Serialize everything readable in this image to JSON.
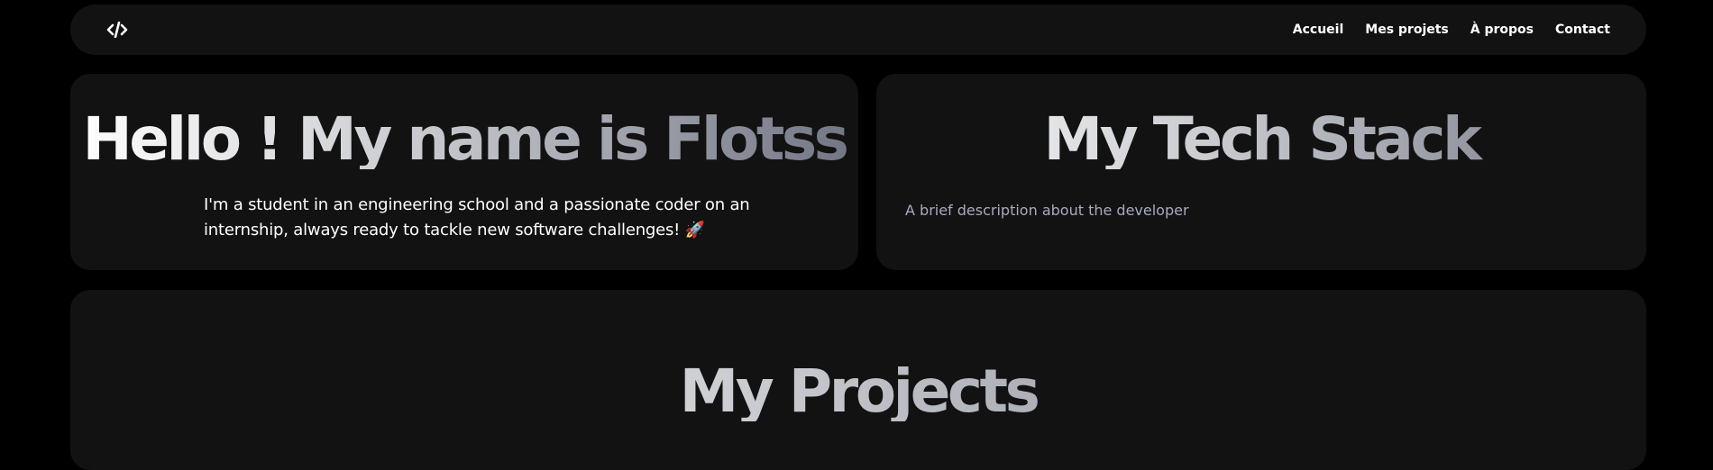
{
  "nav": {
    "logo": {
      "icon": "code-icon"
    },
    "links": [
      {
        "label": "Accueil"
      },
      {
        "label": "Mes projets"
      },
      {
        "label": "À propos"
      },
      {
        "label": "Contact"
      }
    ]
  },
  "hero": {
    "title": "Hello ! My name is Flotss",
    "description": "I'm a student in an engineering school and a passionate coder on an internship, always ready to tackle new software challenges! 🚀",
    "emoji_icon": "rocket-icon"
  },
  "tech_stack": {
    "title": "My Tech Stack",
    "description": "A brief description about the developer"
  },
  "projects": {
    "title": "My Projects"
  },
  "colors": {
    "page_background": "#000000",
    "card_background": "#121212",
    "text_primary": "#ffffff",
    "text_muted": "#a6abc1",
    "gradient_start": "#ffffff",
    "gradient_end": "#717583"
  }
}
